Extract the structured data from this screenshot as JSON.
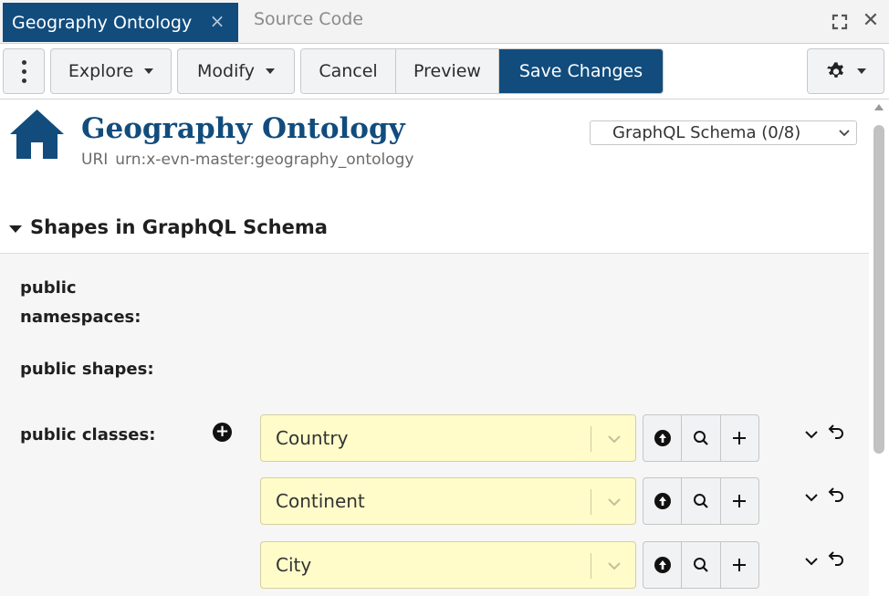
{
  "tabs": {
    "active_label": "Geography Ontology",
    "inactive_label": "Source Code"
  },
  "toolbar": {
    "explore_label": "Explore",
    "modify_label": "Modify",
    "cancel_label": "Cancel",
    "preview_label": "Preview",
    "save_label": "Save Changes",
    "accent_color": "#114c7d"
  },
  "header": {
    "title": "Geography Ontology",
    "uri_label": "URI",
    "uri_value": "urn:x-evn-master:geography_ontology",
    "view_select": "GraphQL Schema (0/8)"
  },
  "section": {
    "title": "Shapes in GraphQL Schema"
  },
  "properties": {
    "namespaces_line1": "public",
    "namespaces_line2": "namespaces:",
    "shapes_label": "public shapes:",
    "classes_label": "public classes:",
    "classes": [
      "Country",
      "Continent",
      "City"
    ]
  },
  "icons": [
    "kebab-menu-icon",
    "caret-down-icon",
    "gear-icon",
    "home-icon",
    "expand-icon",
    "close-icon",
    "arrow-up-circle-icon",
    "search-icon",
    "plus-icon",
    "undo-icon"
  ]
}
